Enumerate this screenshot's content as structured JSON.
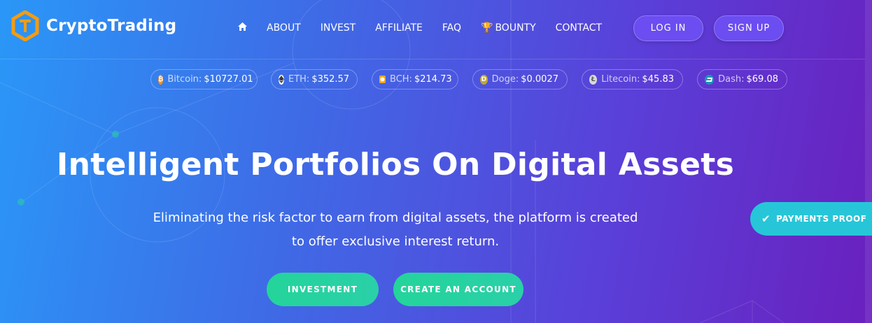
{
  "brand": {
    "name": "CryptoTrading"
  },
  "nav": {
    "home_icon": "home-icon",
    "items": [
      {
        "label": "ABOUT"
      },
      {
        "label": "INVEST"
      },
      {
        "label": "AFFILIATE"
      },
      {
        "label": "FAQ"
      },
      {
        "label": "BOUNTY",
        "icon": "trophy-icon"
      },
      {
        "label": "CONTACT"
      }
    ],
    "login_label": "LOG IN",
    "signup_label": "SIGN UP"
  },
  "ticker": [
    {
      "name": "Bitcoin:",
      "price": "$10727.01",
      "icon": "bitcoin-icon",
      "color": "#f7931a"
    },
    {
      "name": "ETH:",
      "price": "$352.57",
      "icon": "ethereum-icon",
      "color": "#ffffff"
    },
    {
      "name": "BCH:",
      "price": "$214.73",
      "icon": "bitcoin-cash-icon",
      "color": "#f5a623"
    },
    {
      "name": "Doge:",
      "price": "$0.0027",
      "icon": "dogecoin-icon",
      "color": "#c2a633"
    },
    {
      "name": "Litecoin:",
      "price": "$45.83",
      "icon": "litecoin-icon",
      "color": "#d8d8d8"
    },
    {
      "name": "Dash:",
      "price": "$69.08",
      "icon": "dash-icon",
      "color": "#1c75bc"
    }
  ],
  "hero": {
    "title": "Intelligent Portfolios On Digital Assets",
    "subtitle_line1": "Eliminating the risk factor to earn from digital assets, the platform is created",
    "subtitle_line2": "to offer exclusive interest return.",
    "invest_label": "INVESTMENT",
    "create_label": "CREATE AN ACCOUNT"
  },
  "payments_proof": {
    "label": "PAYMENTS PROOF",
    "icon": "check-icon"
  },
  "colors": {
    "accent_green": "#24d49a",
    "proof_teal": "#26c6d8",
    "pill_purple": "#6b4df1",
    "logo_orange": "#f39c12"
  }
}
